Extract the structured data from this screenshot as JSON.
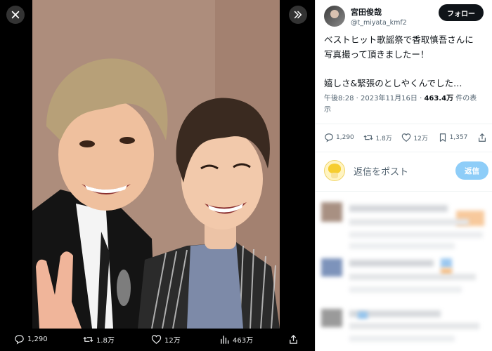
{
  "viewer": {
    "close_icon": "close-icon",
    "expand_icon": "double-chevron-right-icon",
    "photo_alt": "",
    "actions": [
      {
        "icon": "reply-icon",
        "count": "1,290"
      },
      {
        "icon": "retweet-icon",
        "count": "1.8万"
      },
      {
        "icon": "like-icon",
        "count": "12万"
      },
      {
        "icon": "views-icon",
        "count": "463万"
      },
      {
        "icon": "share-icon",
        "count": ""
      }
    ]
  },
  "tweet": {
    "display_name": "宮田俊哉",
    "handle": "@t_miyata_kmf2",
    "follow_label": "フォロー",
    "text_lines": [
      "ベストヒット歌謡祭で香取慎吾さんに",
      "写真撮って頂きましたー！",
      "",
      "嬉しさ&緊張のとしやくんでした…"
    ],
    "time": "午後8:28 · 2023年11月16日 · ",
    "views": "463.4万",
    "views_suffix": " 件の表",
    "views_suffix2": "示",
    "stats": {
      "replies": "1,290",
      "retweets": "1.8万",
      "likes": "12万",
      "bookmarks": "1,357"
    },
    "reply_placeholder": "返信をポスト",
    "reply_button": "返信"
  },
  "colors": {
    "follow_bg": "#0f1419",
    "reply_button_bg": "#8ecdf8",
    "muted_text": "#536471"
  }
}
